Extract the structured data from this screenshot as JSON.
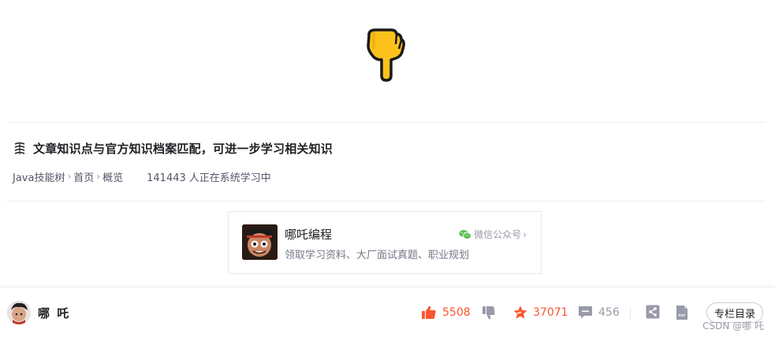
{
  "knowledge": {
    "title": "文章知识点与官方知识档案匹配，可进一步学习相关知识",
    "breadcrumb": [
      "Java技能树",
      "首页",
      "概览"
    ],
    "learners_count": "141443",
    "learners_text": "人正在系统学习中"
  },
  "card": {
    "name": "哪吒编程",
    "desc": "领取学习资料、大厂面试真题、职业规划",
    "wechat_label": "微信公众号"
  },
  "toolbar": {
    "author_name": "哪 吒",
    "like_count": "5508",
    "favorite_count": "37071",
    "comment_count": "456",
    "column_button": "专栏目录",
    "watermark": "CSDN @哪 吒"
  },
  "colors": {
    "accent": "#fc5531",
    "muted": "#999aaa",
    "wechat": "#5ac25a",
    "hand": "#fcc21b"
  },
  "icons": [
    "pointing-down-hand-icon",
    "knowledge-icon",
    "wechat-icon",
    "like-icon",
    "dislike-icon",
    "favorite-icon",
    "comment-icon",
    "share-icon",
    "pdf-icon"
  ]
}
